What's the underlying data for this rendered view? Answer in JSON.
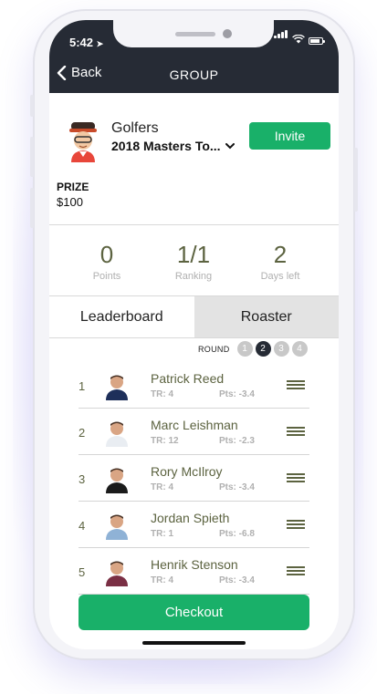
{
  "status_bar": {
    "time": "5:42"
  },
  "nav": {
    "back_label": "Back",
    "title": "GROUP"
  },
  "group": {
    "type": "Golfers",
    "name": "2018 Masters To...",
    "invite_label": "Invite"
  },
  "prize": {
    "label": "PRIZE",
    "value": "$100"
  },
  "stats": [
    {
      "value": "0",
      "label": "Points"
    },
    {
      "value": "1/1",
      "label": "Ranking"
    },
    {
      "value": "2",
      "label": "Days left"
    }
  ],
  "tabs": [
    {
      "label": "Leaderboard",
      "active": true
    },
    {
      "label": "Roaster",
      "active": false
    }
  ],
  "round": {
    "label": "ROUND",
    "options": [
      "1",
      "2",
      "3",
      "4"
    ],
    "selected": "2"
  },
  "players": [
    {
      "rank": "1",
      "name": "Patrick Reed",
      "tr": "TR: 4",
      "pts": "Pts: -3.4",
      "shirt": "#1e2f5a"
    },
    {
      "rank": "2",
      "name": "Marc Leishman",
      "tr": "TR: 12",
      "pts": "Pts: -2.3",
      "shirt": "#e9edf2"
    },
    {
      "rank": "3",
      "name": "Rory McIlroy",
      "tr": "TR: 4",
      "pts": "Pts: -3.4",
      "shirt": "#1b1b1b"
    },
    {
      "rank": "4",
      "name": "Jordan Spieth",
      "tr": "TR: 1",
      "pts": "Pts: -6.8",
      "shirt": "#8fb2d6"
    },
    {
      "rank": "5",
      "name": "Henrik Stenson",
      "tr": "TR: 4",
      "pts": "Pts: -3.4",
      "shirt": "#7a2f44"
    }
  ],
  "checkout_label": "Checkout",
  "colors": {
    "accent_green": "#19b069",
    "header_dark": "#262b35",
    "text_olive": "#5c6340",
    "muted_gray": "#b0b0b0"
  }
}
